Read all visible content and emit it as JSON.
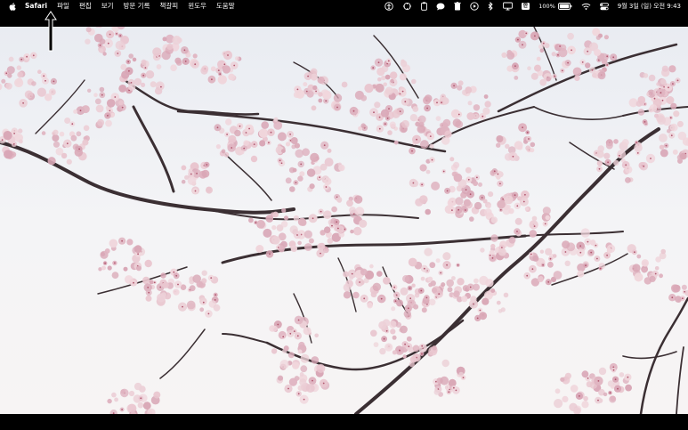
{
  "menubar": {
    "app_name": "Safari",
    "menus": [
      "파일",
      "편집",
      "보기",
      "방문 기록",
      "책갈피",
      "윈도우",
      "도움말"
    ],
    "status": {
      "ime_label": "한",
      "battery_percent": "100%",
      "clock": "9월 3일 (일) 오전 9:43"
    }
  },
  "icons": {
    "apple": "apple-logo-icon",
    "status": [
      "accessibility-icon",
      "sync-icon",
      "clipboard-icon",
      "messages-icon",
      "trash-icon",
      "play-icon",
      "bluetooth-icon",
      "display-icon",
      "battery-icon",
      "wifi-icon",
      "control-center-icon"
    ]
  },
  "desktop": {
    "wallpaper": "cherry-blossom-photo"
  },
  "colors": {
    "menubar_bg": "#000000",
    "sky": "#eceef3",
    "branch": "#3b2f33",
    "blossom": "#e7c7cf"
  }
}
